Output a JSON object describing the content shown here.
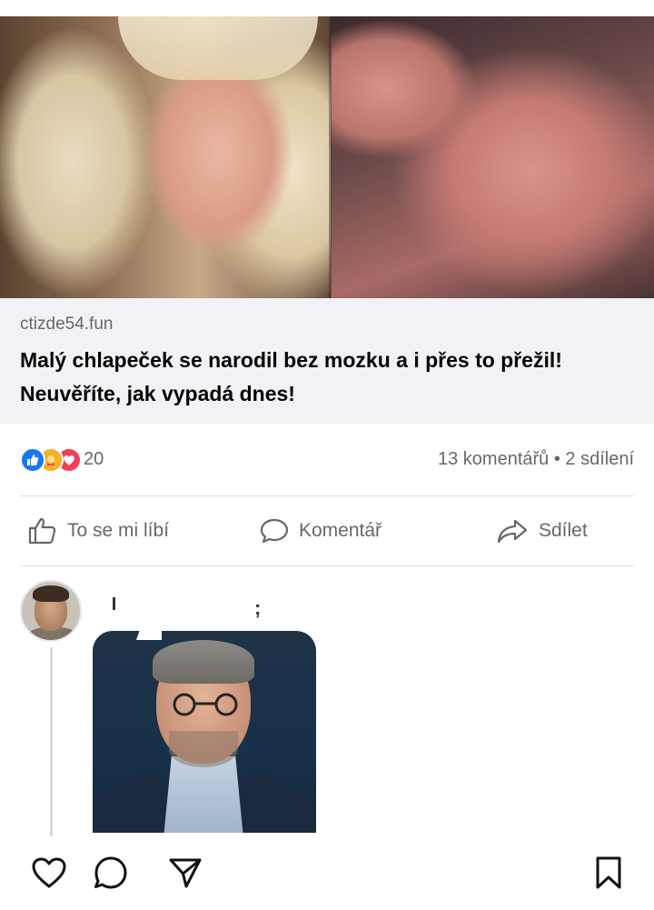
{
  "link_preview": {
    "domain": "ctizde54.fun",
    "title": "Malý chlapeček se narodil bez mozku a i přes to přežil! Neuvěříte, jak vypadá dnes!",
    "image_left": "woman-portrait-photo",
    "image_right": "newborn-baby-photo"
  },
  "reactions": {
    "icons": [
      "like-reaction-icon",
      "care-reaction-icon",
      "love-reaction-icon"
    ],
    "count": "20",
    "comments_shares": "13 komentářů • 2 sdílení",
    "colors": {
      "like": "#1877f2",
      "care": "#f7b125",
      "love": "#f33e58"
    }
  },
  "actions": {
    "like_label": "To se mi líbí",
    "comment_label": "Komentář",
    "share_label": "Sdílet"
  },
  "comment": {
    "author_redacted": true,
    "photo": "man-with-glasses-photo"
  },
  "bottom_bar": {
    "icons": [
      "heart-icon",
      "comment-bubble-icon",
      "send-icon",
      "bookmark-icon"
    ]
  }
}
